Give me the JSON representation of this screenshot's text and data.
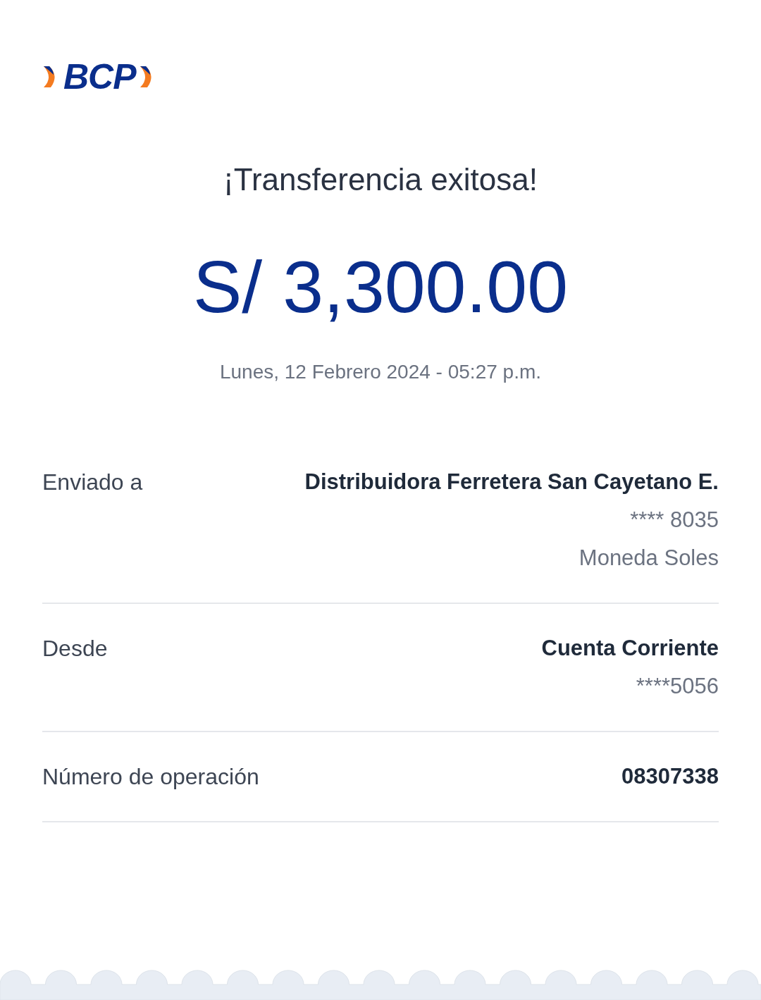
{
  "logo": {
    "text": "BCP"
  },
  "title": "¡Transferencia exitosa!",
  "amount": "S/ 3,300.00",
  "datetime": "Lunes, 12 Febrero 2024 - 05:27 p.m.",
  "rows": [
    {
      "label": "Enviado a",
      "values": [
        {
          "text": "Distribuidora Ferretera San Cayetano E.",
          "kind": "primary"
        },
        {
          "text": "**** 8035",
          "kind": "secondary"
        },
        {
          "text": "Moneda Soles",
          "kind": "secondary"
        }
      ]
    },
    {
      "label": "Desde",
      "values": [
        {
          "text": "Cuenta Corriente",
          "kind": "primary"
        },
        {
          "text": "****5056",
          "kind": "secondary"
        }
      ]
    },
    {
      "label": "Número de operación",
      "values": [
        {
          "text": "08307338",
          "kind": "primary"
        }
      ]
    }
  ]
}
